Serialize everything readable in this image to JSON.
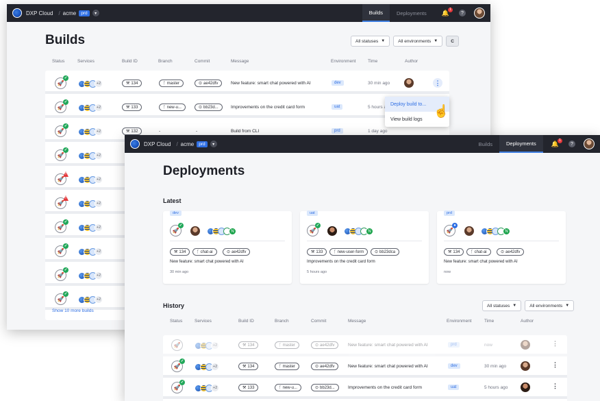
{
  "colors": {
    "topbar": "#23252d",
    "accent": "#2f6fe3",
    "success": "#22a85a",
    "error": "#e5383b"
  },
  "builds_window": {
    "topbar": {
      "brand": "DXP Cloud",
      "separator": "/",
      "org": "acme",
      "env": "prd",
      "tabs": [
        "Builds",
        "Deployments"
      ],
      "active_tab": "Builds",
      "notification_count": "1",
      "help": "?"
    },
    "title": "Builds",
    "filters": {
      "status": "All statuses",
      "environment": "All environments",
      "extra": "C"
    },
    "columns": [
      "Status",
      "Services",
      "Build ID",
      "Branch",
      "Commit",
      "Message",
      "Environment",
      "Time",
      "Author"
    ],
    "rows": [
      {
        "status": "success",
        "services_extra": "+2",
        "build_id": "134",
        "branch": "master",
        "commit": "ae42dfv",
        "message": "New feature: smart chat powered with AI",
        "env": "dev",
        "time": "30 min ago"
      },
      {
        "status": "success",
        "services_extra": "+2",
        "build_id": "133",
        "branch": "new-u...",
        "commit": "bb23d...",
        "message": "Improvements on the credit card form",
        "env": "uat",
        "time": "5 hours ago"
      },
      {
        "status": "success",
        "services_extra": "+2",
        "build_id": "132",
        "branch": "-",
        "commit": "-",
        "message": "Build from CLI",
        "env": "prd",
        "time": "1 day ago"
      },
      {
        "status": "success",
        "services_extra": "+2"
      },
      {
        "status": "error",
        "services_extra": "+2"
      },
      {
        "status": "error",
        "services_extra": "+2"
      },
      {
        "status": "success",
        "services_extra": "+2"
      },
      {
        "status": "success",
        "services_extra": "+2"
      },
      {
        "status": "success",
        "services_extra": "+2"
      },
      {
        "status": "success",
        "services_extra": "+2"
      }
    ],
    "menu": [
      "Deploy build to...",
      "View build logs"
    ],
    "show_more": "Show 10 more builds"
  },
  "deployments_window": {
    "topbar": {
      "brand": "DXP Cloud",
      "separator": "/",
      "org": "acme",
      "env": "prd",
      "tabs": [
        "Builds",
        "Deployments"
      ],
      "active_tab": "Deployments",
      "notification_count": "1",
      "help": "?"
    },
    "title": "Deployments",
    "latest_title": "Latest",
    "latest": [
      {
        "env": "dev",
        "build_id": "134",
        "branch": "chat-ai",
        "commit": "ae42dfv",
        "message": "New feature: smart chat powered with AI",
        "time": "30 min ago",
        "status": "success"
      },
      {
        "env": "uat",
        "build_id": "133",
        "branch": "new-user-form",
        "commit": "bb23dca",
        "message": "Improvements on the credit card form",
        "time": "5 hours ago",
        "status": "success"
      },
      {
        "env": "prd",
        "build_id": "134",
        "branch": "chat-ai",
        "commit": "ae42dfv",
        "message": "New feature: smart chat powered with AI",
        "time": "now",
        "status": "running"
      }
    ],
    "history_title": "History",
    "history_filters": {
      "status": "All statuses",
      "environment": "All environments"
    },
    "history_columns": [
      "Status",
      "Services",
      "Build ID",
      "Branch",
      "Commit",
      "Message",
      "Environment",
      "Time",
      "Author"
    ],
    "history_rows": [
      {
        "build_id": "134",
        "branch": "master",
        "commit": "ae42dfv",
        "message": "New feature: smart chat powered with AI",
        "env": "prd",
        "time": "now",
        "services_extra": "+2",
        "faded": true
      },
      {
        "build_id": "134",
        "branch": "master",
        "commit": "ae42dfv",
        "message": "New feature: smart chat powered with AI",
        "env": "dev",
        "time": "30 min ago",
        "services_extra": "+2"
      },
      {
        "build_id": "133",
        "branch": "new-u...",
        "commit": "bb23d...",
        "message": "Improvements on the credit card form",
        "env": "uat",
        "time": "5 hours ago",
        "services_extra": "+2"
      }
    ]
  }
}
